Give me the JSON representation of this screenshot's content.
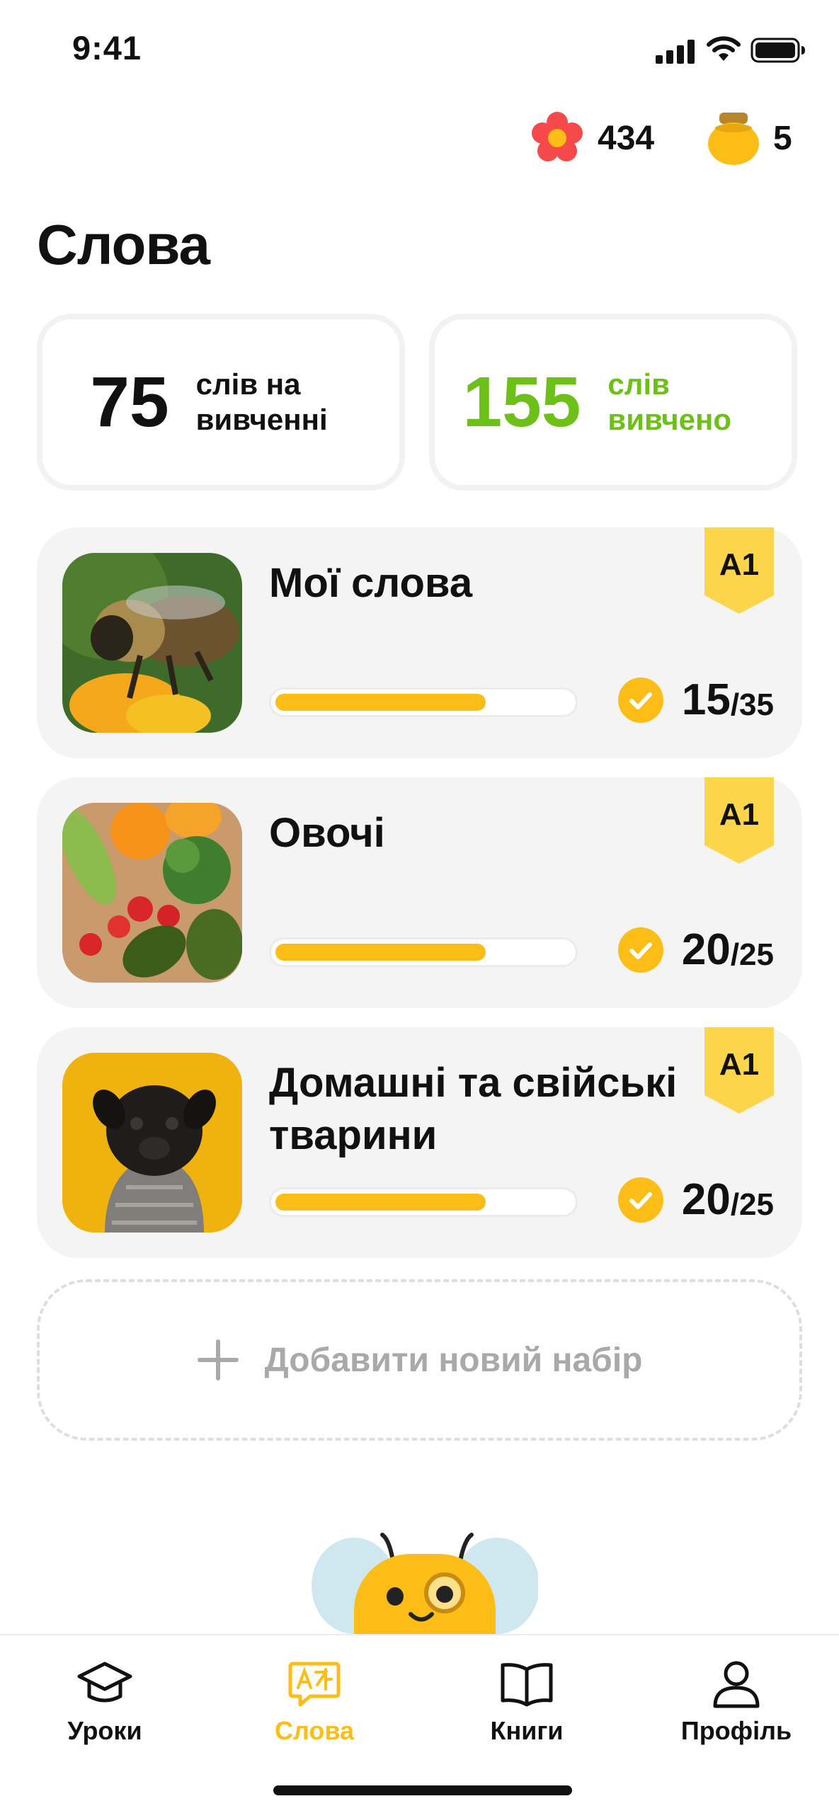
{
  "status_bar": {
    "time": "9:41",
    "icons": [
      "signal-icon",
      "wifi-icon",
      "battery-icon"
    ]
  },
  "counters": {
    "flowers": {
      "icon": "flower-icon",
      "value": "434"
    },
    "honey": {
      "icon": "honey-jar-icon",
      "value": "5"
    }
  },
  "page": {
    "title": "Слова"
  },
  "stats": {
    "learning": {
      "number": "75",
      "label": "слів на вивченні"
    },
    "learned": {
      "number": "155",
      "label": "слів вивчено",
      "color": "#6cc018"
    }
  },
  "word_sets": [
    {
      "title": "Мої слова",
      "level": "A1",
      "done": "15",
      "total": "35",
      "progress": 0.71,
      "image": "bee-photo"
    },
    {
      "title": "Овочі",
      "level": "A1",
      "done": "20",
      "total": "25",
      "progress": 0.71,
      "image": "vegetables-photo"
    },
    {
      "title": "Домашні та свійські тварини",
      "level": "A1",
      "done": "20",
      "total": "25",
      "progress": 0.71,
      "image": "pug-photo"
    }
  ],
  "add_set": {
    "label": "Добавити новий набір",
    "icon": "plus-icon"
  },
  "tabs": [
    {
      "label": "Уроки",
      "icon": "graduation-cap-icon",
      "active": false
    },
    {
      "label": "Слова",
      "icon": "translate-chat-icon",
      "active": true
    },
    {
      "label": "Книги",
      "icon": "book-icon",
      "active": false
    },
    {
      "label": "Профіль",
      "icon": "person-icon",
      "active": false
    }
  ],
  "colors": {
    "accent": "#fbbd16",
    "learned_green": "#6cc018",
    "card_bg": "#f4f4f4",
    "flower": "#f6494a"
  }
}
